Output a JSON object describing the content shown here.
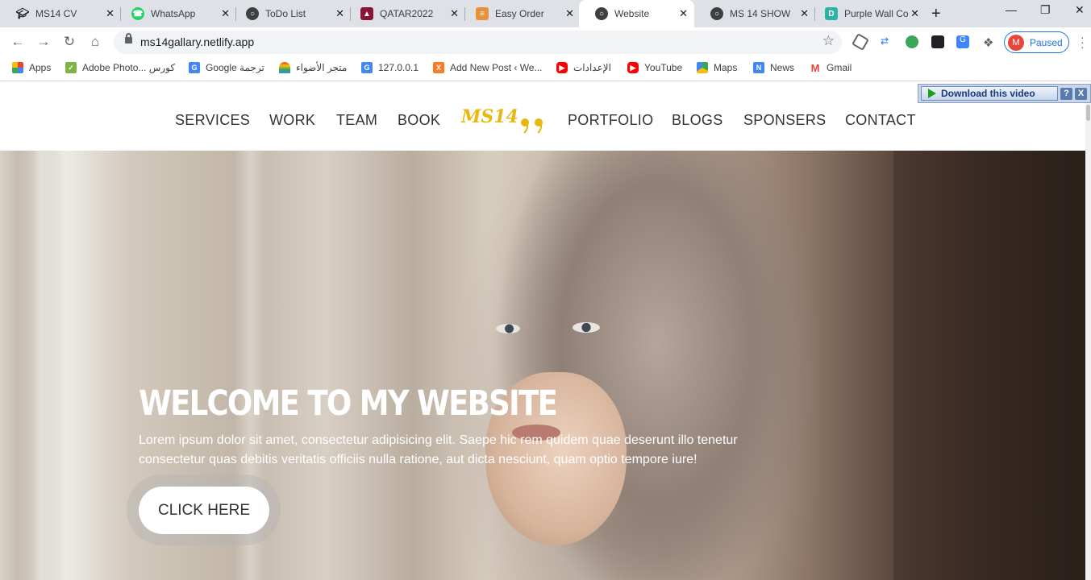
{
  "browser": {
    "tabs": [
      {
        "title": "MS14 CV",
        "icon": "graduation-cap-icon",
        "color": "#202124"
      },
      {
        "title": "WhatsApp",
        "icon": "whatsapp-icon",
        "color": "#25d366"
      },
      {
        "title": "ToDo List",
        "icon": "globe-icon",
        "color": "#3c4043"
      },
      {
        "title": "QATAR2022",
        "icon": "qatar-icon",
        "color": "#8a1538"
      },
      {
        "title": "Easy Order",
        "icon": "document-icon",
        "color": "#e8913a"
      },
      {
        "title": "Website",
        "icon": "globe-icon",
        "color": "#3c4043",
        "active": true
      },
      {
        "title": "MS 14 SHOW",
        "icon": "globe-icon",
        "color": "#3c4043"
      },
      {
        "title": "Purple Wall Co",
        "icon": "d-icon",
        "color": "#2ab3a6"
      }
    ],
    "new_tab": "+",
    "url": "ms14gallary.netlify.app",
    "profile_initial": "M",
    "profile_status": "Paused",
    "bookmarks": [
      {
        "label": "Apps",
        "icon": "apps-grid-icon",
        "color": "#ea4335"
      },
      {
        "label": "Adobe Photo... كورس",
        "icon": "check-icon",
        "color": "#7cb342"
      },
      {
        "label": "Google ترجمة",
        "icon": "translate-icon",
        "color": "#4285f4"
      },
      {
        "label": "متجر الأضواء",
        "icon": "rainbow-icon",
        "color": "#f4b400"
      },
      {
        "label": "127.0.0.1",
        "icon": "translate-icon",
        "color": "#4285f4"
      },
      {
        "label": "Add New Post ‹ We...",
        "icon": "xampp-icon",
        "color": "#fb7a24"
      },
      {
        "label": "الإعدادات",
        "icon": "youtube-icon",
        "color": "#ff0000"
      },
      {
        "label": "YouTube",
        "icon": "youtube-icon",
        "color": "#ff0000"
      },
      {
        "label": "Maps",
        "icon": "maps-icon",
        "color": "#34a853"
      },
      {
        "label": "News",
        "icon": "news-icon",
        "color": "#4285f4"
      },
      {
        "label": "Gmail",
        "icon": "gmail-icon",
        "color": "#ea4335"
      }
    ]
  },
  "download_bar": {
    "label": "Download this video",
    "help": "?",
    "close": "X"
  },
  "site": {
    "nav_left": [
      "SERVICES",
      "WORK",
      "TEAM",
      "BOOK"
    ],
    "logo": "MS14",
    "nav_right": [
      "PORTFOLIO",
      "BLOGS",
      "SPONSERS",
      "CONTACT"
    ],
    "hero": {
      "title": "WELCOME TO MY WEBSITE",
      "text": "Lorem ipsum dolor sit amet, consectetur adipisicing elit. Saepe hic rem quidem quae deserunt illo tenetur consectetur quas debitis veritatis officiis nulla ratione, aut dicta nesciunt, quam optio tempore iure!",
      "button": "CLICK HERE"
    }
  }
}
